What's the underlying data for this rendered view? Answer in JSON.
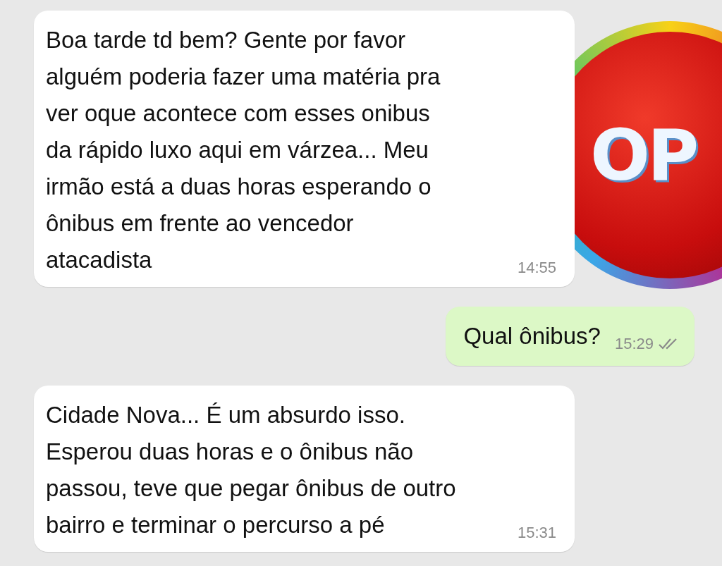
{
  "logo": {
    "text": "OP"
  },
  "messages": [
    {
      "kind": "incoming",
      "text": "Boa tarde td bem? Gente por favor\nalguém poderia fazer uma matéria pra\nver oque acontece com esses onibus\nda rápido luxo aqui em várzea... Meu\nirmão está a duas horas esperando o\nônibus em frente ao vencedor\natacadista",
      "time": "14:55"
    },
    {
      "kind": "outgoing",
      "text": "Qual ônibus?",
      "time": "15:29",
      "read": false
    },
    {
      "kind": "incoming",
      "text": "Cidade Nova... É um absurdo isso.\nEsperou duas horas e o ônibus não\npassou, teve que pegar ônibus de outro\nbairro e terminar o percurso a pé",
      "time": "15:31"
    }
  ]
}
